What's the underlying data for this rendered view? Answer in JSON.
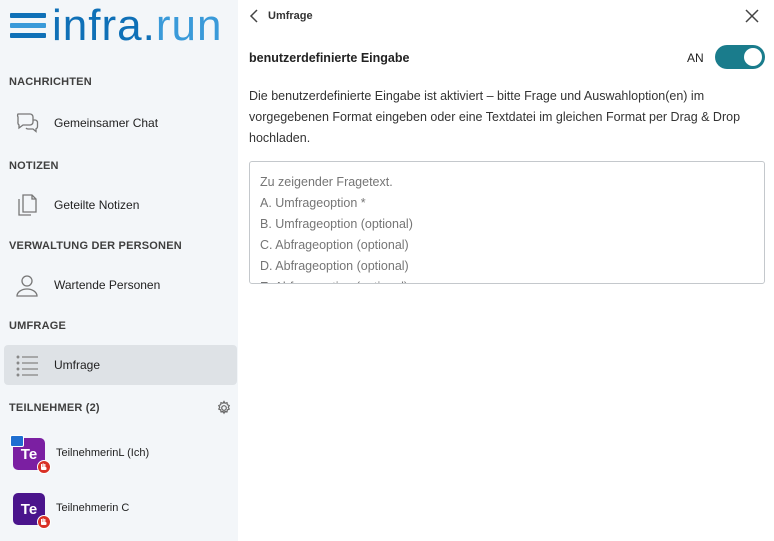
{
  "app": {
    "logo_part1": "infra.",
    "logo_part2": "run"
  },
  "sidebar": {
    "sections": [
      {
        "title": "NACHRICHTEN"
      },
      {
        "title": "NOTIZEN"
      },
      {
        "title": "VERWALTUNG DER PERSONEN"
      },
      {
        "title": "UMFRAGE"
      },
      {
        "title": "TEILNEHMER (2)"
      }
    ],
    "items": [
      {
        "label": "Gemeinsamer Chat",
        "icon": "chat-bubbles-icon"
      },
      {
        "label": "Geteilte Notizen",
        "icon": "notes-icon"
      },
      {
        "label": "Wartende Personen",
        "icon": "person-icon"
      },
      {
        "label": "Umfrage",
        "icon": "list-icon",
        "active": true
      }
    ],
    "participants": [
      {
        "initials": "Te",
        "name": "TeilnehmerinL (Ich)",
        "color": "#7b1fa2"
      },
      {
        "initials": "Te",
        "name": "Teilnehmerin C",
        "color": "#4a148c"
      }
    ]
  },
  "main": {
    "header_title": "Umfrage",
    "toggle_label": "benutzerdefinierte Eingabe",
    "toggle_state": "AN",
    "description": "Die benutzerdefinierte Eingabe ist aktiviert – bitte Frage und Auswahloption(en) im vorgegebenen Format eingeben oder eine Textdatei im gleichen Format per Drag & Drop hochladen.",
    "textarea_placeholder": "Zu zeigender Fragetext.\nA. Umfrageoption *\nB. Umfrageoption (optional)\nC. Abfrageoption (optional)\nD. Abfrageoption (optional)\nE. Abfrageoption (optional)"
  },
  "colors": {
    "brand_blue": "#0f70b7",
    "brand_light_blue": "#3a9ad9",
    "toggle_on": "#1a7c8c",
    "hand_badge": "#d93025"
  }
}
